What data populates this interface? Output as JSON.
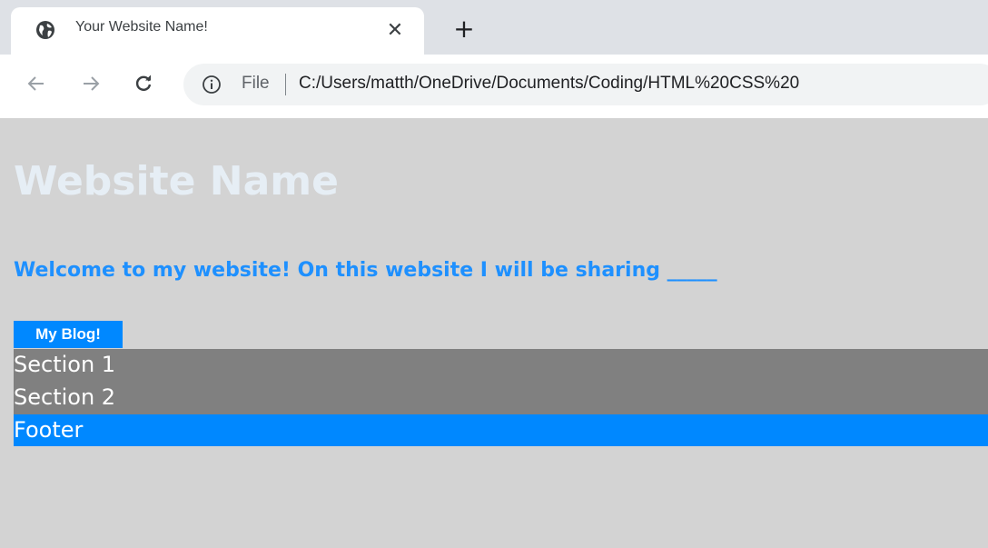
{
  "browser": {
    "tab": {
      "title": "Your Website Name!",
      "favicon_icon": "globe-icon",
      "close_label": "✕"
    },
    "new_tab_label": "+",
    "toolbar": {
      "back_icon": "back-arrow-icon",
      "forward_icon": "forward-arrow-icon",
      "reload_icon": "reload-icon",
      "info_icon": "info-icon",
      "scheme_label": "File",
      "url": "C:/Users/matth/OneDrive/Documents/Coding/HTML%20CSS%20"
    }
  },
  "page": {
    "title": "Website Name",
    "welcome": "Welcome to my website! On this website I will be sharing _____",
    "blog_button": "My Blog!",
    "sections": [
      "Section 1",
      "Section 2"
    ],
    "footer": "Footer"
  },
  "colors": {
    "page_background": "#d3d3d3",
    "title": "#e6eef5",
    "welcome_text": "#1e90ff",
    "button_background": "#0088ff",
    "section_background": "#808080",
    "footer_background": "#0088ff"
  }
}
